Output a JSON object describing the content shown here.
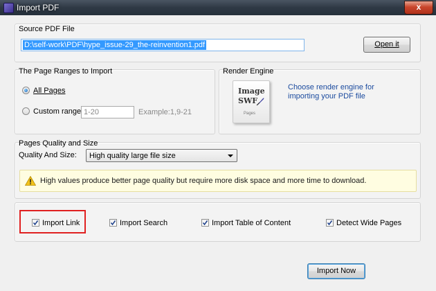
{
  "window": {
    "title": "Import PDF",
    "close_glyph": "x",
    "icon": "app-icon"
  },
  "source": {
    "group_title": "Source PDF File",
    "path_value": "D:\\self-work\\PDF\\hype_issue-29_the-reinvention1.pdf",
    "open_button": "Open it"
  },
  "ranges": {
    "group_title": "The Page Ranges to Import",
    "all_pages_label": "All Pages",
    "all_pages_selected": true,
    "custom_range_label": "Custom range:",
    "custom_range_selected": false,
    "custom_range_value": "1-20",
    "example_text": "Example:1,9-21"
  },
  "engine": {
    "group_title": "Render Engine",
    "icon_line1": "Image",
    "icon_line2": "SWF",
    "icon_line3": "Pages",
    "description": "Choose render engine for importing your PDF file"
  },
  "quality": {
    "group_title": "Pages Quality and Size",
    "field_label": "Quality And Size:",
    "selected_option": "High quality large file size",
    "warning_text": "High values produce better page quality but require more disk space and more time to download.",
    "warning_icon": "warning-icon"
  },
  "options": [
    {
      "label": "Import Link",
      "checked": true
    },
    {
      "label": "Import Search",
      "checked": true
    },
    {
      "label": "Import Table of Content",
      "checked": true
    },
    {
      "label": "Detect Wide Pages",
      "checked": true
    }
  ],
  "actions": {
    "import_button": "Import Now"
  },
  "colors": {
    "highlight": "#e02020",
    "selection": "#3399ff",
    "link_text": "#1a4a9e"
  }
}
